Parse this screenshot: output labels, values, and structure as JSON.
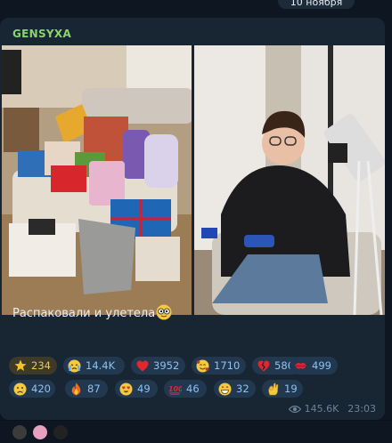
{
  "date_label": "10 ноября",
  "post": {
    "sender": "GENSYXA",
    "caption": "Распаковали и улетела",
    "caption_emoji": "face-with-glasses-emoji",
    "views": "145.6K",
    "time": "23:03"
  },
  "reactions": [
    {
      "icon": "star-icon",
      "count": "234",
      "active": true
    },
    {
      "icon": "crying-face-icon",
      "count": "14.4K"
    },
    {
      "icon": "red-heart-icon",
      "count": "3952"
    },
    {
      "icon": "smiling-face-with-hearts-icon",
      "count": "1710"
    },
    {
      "icon": "broken-heart-icon",
      "count": "586"
    },
    {
      "icon": "kiss-mark-icon",
      "count": "499"
    },
    {
      "icon": "sad-face-icon",
      "count": "420"
    },
    {
      "icon": "fire-icon",
      "count": "87"
    },
    {
      "icon": "heart-eyes-icon",
      "count": "49"
    },
    {
      "icon": "hundred-points-icon",
      "count": "46"
    },
    {
      "icon": "grinning-face-icon",
      "count": "32"
    },
    {
      "icon": "ok-hand-icon",
      "count": "19"
    }
  ],
  "colors": {
    "background": "#0e1621",
    "bubble": "#182533",
    "sender": "#8bd36f",
    "reaction_bg": "#22384f",
    "reaction_text": "#8ec2f3",
    "star_reaction_bg": "#3d3a2a",
    "star_reaction_text": "#e9c46a"
  }
}
